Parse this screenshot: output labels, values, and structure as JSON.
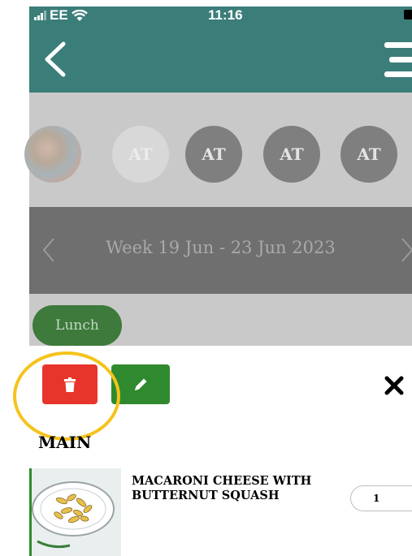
{
  "status_bar": {
    "carrier": "EE",
    "time": "11:16",
    "icons": [
      "signal-icon",
      "wifi-icon",
      "battery-icon"
    ]
  },
  "header": {
    "back_icon": "chevron-left-icon",
    "menu_icon": "hamburger-menu-icon"
  },
  "avatars": [
    {
      "initials": "",
      "type": "photo"
    },
    {
      "initials": "AT",
      "type": "initials"
    },
    {
      "initials": "AT",
      "type": "initials"
    },
    {
      "initials": "AT",
      "type": "initials"
    },
    {
      "initials": "AT",
      "type": "initials"
    }
  ],
  "week": {
    "label": "Week 19 Jun - 23 Jun 2023"
  },
  "meal_tab": {
    "label": "Lunch"
  },
  "sheet": {
    "delete_icon": "trash-icon",
    "edit_icon": "pencil-icon",
    "close_icon": "close-icon",
    "section_title": "MAIN",
    "dish": {
      "name": "MACARONI CHEESE WITH BUTTERNUT SQUASH",
      "quantity": "1"
    }
  },
  "colors": {
    "header": "#3b7d79",
    "delete": "#e8352b",
    "edit": "#2f8a2f",
    "highlight": "#f5c31c",
    "meal_pill": "#3d7a3c"
  }
}
